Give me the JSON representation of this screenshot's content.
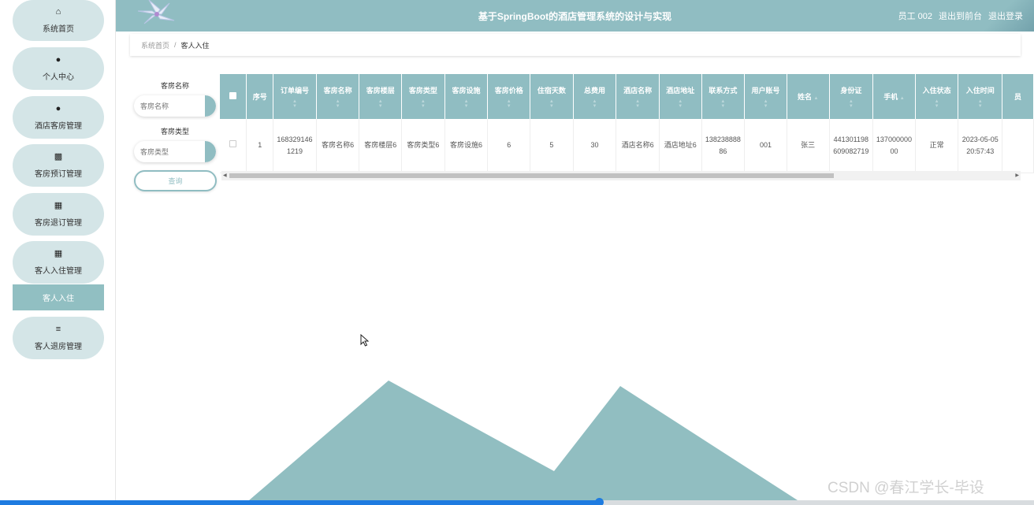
{
  "header": {
    "title": "基于SpringBoot的酒店管理系统的设计与实现",
    "user": "员工 002",
    "front_link": "退出到前台",
    "logout": "退出登录"
  },
  "sidebar": {
    "items": [
      {
        "label": "系统首页",
        "icon": "home-icon"
      },
      {
        "label": "个人中心",
        "icon": "user-icon"
      },
      {
        "label": "酒店客房管理",
        "icon": "user-icon"
      },
      {
        "label": "客房预订管理",
        "icon": "briefcase-icon"
      },
      {
        "label": "客房退订管理",
        "icon": "grid-icon"
      },
      {
        "label": "客人入住管理",
        "icon": "grid-icon"
      }
    ],
    "sub_item": "客人入住",
    "last_item": {
      "label": "客人退房管理",
      "icon": "sliders-icon"
    }
  },
  "breadcrumb": {
    "home": "系统首页",
    "sep": "/",
    "current": "客人入住"
  },
  "search": {
    "room_name_label": "客房名称",
    "room_name_placeholder": "客房名称",
    "room_type_label": "客房类型",
    "room_type_placeholder": "客房类型",
    "query_button": "查询"
  },
  "table": {
    "headers": [
      "序号",
      "订单编号",
      "客房名称",
      "客房楼层",
      "客房类型",
      "客房设施",
      "客房价格",
      "住宿天数",
      "总费用",
      "酒店名称",
      "酒店地址",
      "联系方式",
      "用户账号",
      "姓名",
      "身份证",
      "手机",
      "入住状态",
      "入住时间",
      "员"
    ],
    "rows": [
      [
        "1",
        "1683291461219",
        "客房名称6",
        "客房楼层6",
        "客房类型6",
        "客房设施6",
        "6",
        "5",
        "30",
        "酒店名称6",
        "酒店地址6",
        "13823888886",
        "001",
        "张三",
        "441301198609082719",
        "13700000000",
        "正常",
        "2023-05-05 20:57:43",
        ""
      ]
    ]
  },
  "watermark": "CSDN @春江学长-毕设",
  "colors": {
    "accent": "#90bdc2",
    "pill": "#d4e5e7",
    "progress": "#1e7be0"
  },
  "video_progress": 0.58
}
